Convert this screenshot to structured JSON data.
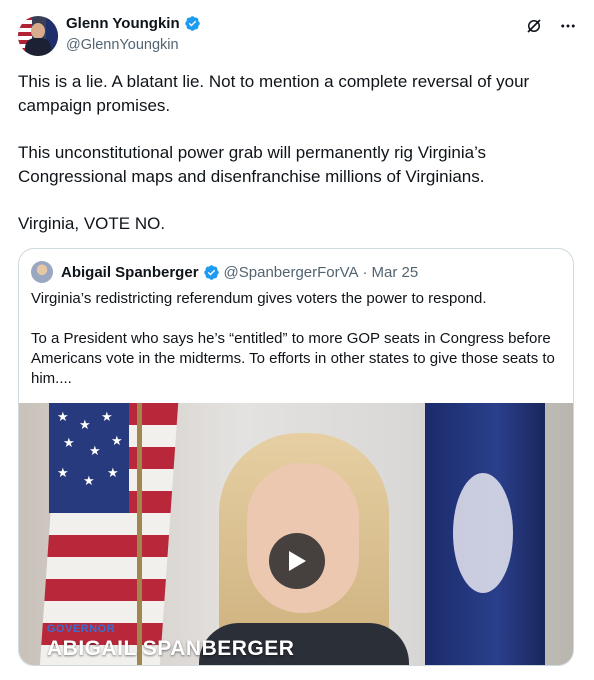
{
  "author": {
    "display_name": "Glenn Youngkin",
    "handle": "@GlennYoungkin",
    "verified": true
  },
  "icons": {
    "grok": "grok-icon",
    "more": "more-icon",
    "verified": "verified-badge-icon",
    "play": "play-icon"
  },
  "colors": {
    "verified": "#1d9bf0",
    "secondary_text": "#536471",
    "border": "#cfd9de"
  },
  "tweet": {
    "paragraphs": [
      "This is a lie. A blatant lie. Not to mention a complete reversal of your campaign promises.",
      "This unconstitutional power grab will permanently rig Virginia’s Congressional maps and disenfranchise millions of Virginians.",
      "Virginia, VOTE NO."
    ]
  },
  "quote": {
    "display_name": "Abigail Spanberger",
    "handle": "@SpanbergerForVA",
    "separator": "·",
    "date": "Mar 25",
    "paragraphs": [
      "Virginia’s redistricting referendum gives voters the power to respond.",
      "To a President who says he’s “entitled” to more GOP seats in Congress before Americans vote in the midterms. To efforts in other states to give those seats to him...."
    ],
    "media": {
      "chyron_sub": "GOVERNOR",
      "chyron": "ABIGAIL SPANBERGER"
    }
  }
}
